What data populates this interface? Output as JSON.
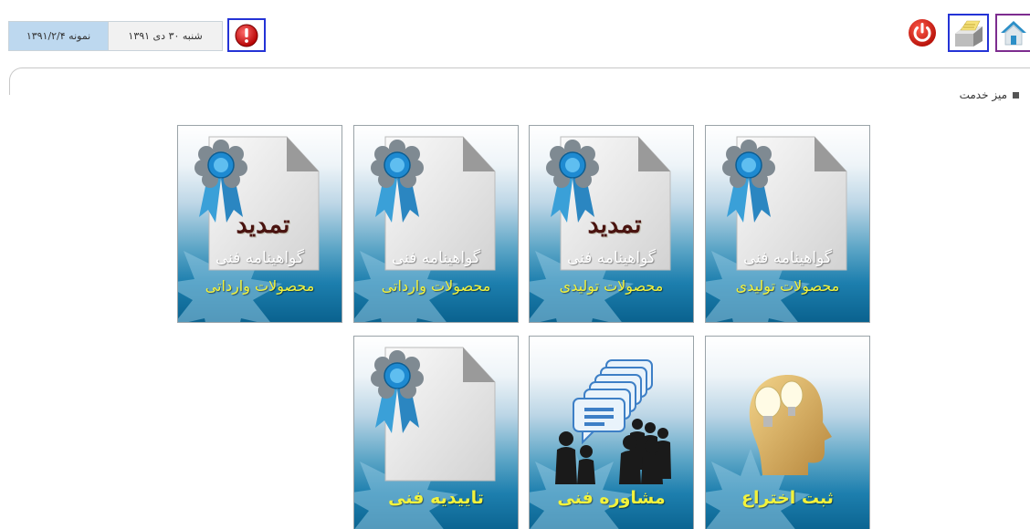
{
  "header": {
    "today_text": "شنبه ۳۰ دی ۱۳۹۱",
    "version_text": "نمونه ۱۳۹۱/۲/۴",
    "icons": {
      "alert": "alert-icon",
      "power": "power-icon",
      "printer": "printer-icon",
      "home": "home-icon"
    }
  },
  "breadcrumb": {
    "label": "میز خدمت"
  },
  "tiles": [
    {
      "line1": "گواهینامه فنی",
      "line2": "محصولات تولیدی",
      "renew": ""
    },
    {
      "line1": "گواهینامه فنی",
      "line2": "محصولات تولیدی",
      "renew": "تمدید"
    },
    {
      "line1": "گواهینامه فنی",
      "line2": "محصولات وارداتی",
      "renew": ""
    },
    {
      "line1": "گواهینامه فنی",
      "line2": "محصولات وارداتی",
      "renew": "تمدید"
    },
    {
      "label": "ثبت اختراع"
    },
    {
      "label": "مشاوره فنی"
    },
    {
      "label": "تاییدیه فنی"
    }
  ],
  "colors": {
    "tile_text_accent": "#f2f23c",
    "header_blue": "#2433d6",
    "header_purple": "#7d2c8f"
  }
}
